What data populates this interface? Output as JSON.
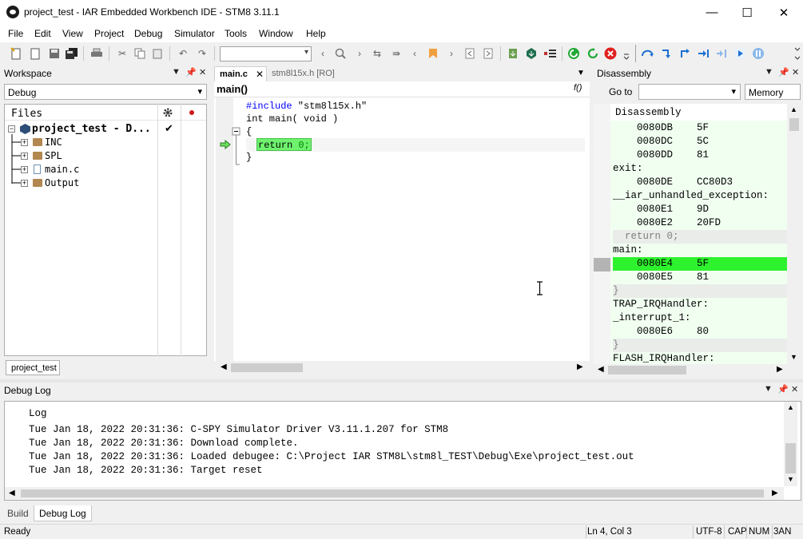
{
  "window": {
    "title": "project_test - IAR Embedded Workbench IDE - STM8 3.11.1",
    "minimize": "—",
    "maximize": "☐",
    "close": "✕"
  },
  "menu": [
    "File",
    "Edit",
    "View",
    "Project",
    "Debug",
    "Simulator",
    "Tools",
    "Window",
    "Help"
  ],
  "workspace": {
    "title": "Workspace",
    "config": "Debug",
    "files_header": "Files",
    "project": "project_test - D...",
    "items": [
      "INC",
      "SPL",
      "main.c",
      "Output"
    ],
    "tab": "project_test"
  },
  "editor": {
    "tabs": [
      "main.c",
      "stm8l15x.h [RO]"
    ],
    "function": "main()",
    "func_icon": "f()",
    "lines": {
      "l1_pp": "#include",
      "l1_str": " \"stm8l15x.h\"",
      "l2": "int main( void )",
      "l3": "{",
      "l4_kw": "return",
      "l4_num": " 0;",
      "l5": "}"
    }
  },
  "disassembly": {
    "title": "Disassembly",
    "goto_label": "Go to",
    "memory_label": "Memory",
    "header": "Disassembly",
    "lines": [
      {
        "t": "    0080DB    5F",
        "k": "code"
      },
      {
        "t": "    0080DC    5C",
        "k": "code"
      },
      {
        "t": "    0080DD    81",
        "k": "code"
      },
      {
        "t": "exit:",
        "k": "label"
      },
      {
        "t": "    0080DE    CC80D3",
        "k": "code"
      },
      {
        "t": "__iar_unhandled_exception:",
        "k": "label"
      },
      {
        "t": "    0080E1    9D",
        "k": "code"
      },
      {
        "t": "    0080E2    20FD",
        "k": "code"
      },
      {
        "t": "  return 0;",
        "k": "src"
      },
      {
        "t": "main:",
        "k": "label"
      },
      {
        "t": "    0080E4    5F",
        "k": "cur"
      },
      {
        "t": "    0080E5    81",
        "k": "code"
      },
      {
        "t": "}",
        "k": "src"
      },
      {
        "t": "TRAP_IRQHandler:",
        "k": "label"
      },
      {
        "t": "_interrupt_1:",
        "k": "label"
      },
      {
        "t": "    0080E6    80",
        "k": "code"
      },
      {
        "t": "}",
        "k": "src"
      },
      {
        "t": "FLASH_IRQHandler:",
        "k": "label"
      }
    ]
  },
  "debuglog": {
    "title": "Debug Log",
    "header": "Log",
    "lines": [
      "Tue Jan 18, 2022 20:31:36: C-SPY Simulator Driver V3.11.1.207 for STM8",
      "Tue Jan 18, 2022 20:31:36: Download complete.",
      "Tue Jan 18, 2022 20:31:36: Loaded debugee: C:\\Project IAR STM8L\\stm8l_TEST\\Debug\\Exe\\project_test.out",
      "Tue Jan 18, 2022 20:31:36: Target reset"
    ],
    "tabs": [
      "Build",
      "Debug Log"
    ]
  },
  "status": {
    "left": "Ready",
    "position": "Ln 4, Col 3",
    "encoding": "UTF-8",
    "cap": "CAP",
    "num": "NUM",
    "ovr": "3AN"
  },
  "colors": {
    "current_line": "#2ef22e",
    "dis_bg": "#f1fff1",
    "preprocessor": "#0000ff",
    "number": "#008000"
  }
}
